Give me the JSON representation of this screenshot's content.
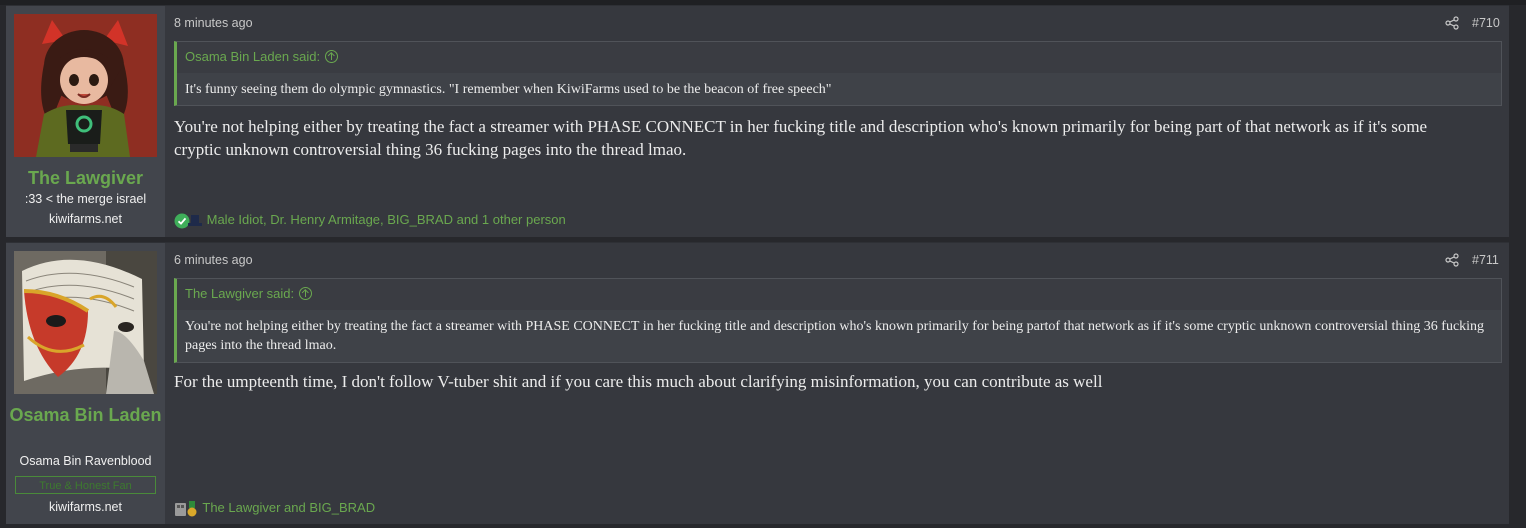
{
  "posts": [
    {
      "author": "The Lawgiver",
      "user_title": ":33 < the merge israel",
      "user_extra": "kiwifarms.net",
      "time": "8 minutes ago",
      "post_number": "#710",
      "quote": {
        "author_line": "Osama Bin Laden said:",
        "text": "It's funny seeing them do olympic gymnastics. \"I remember when KiwiFarms used to be the beacon of free speech\""
      },
      "message": "You're not helping either by treating the fact a streamer with PHASE CONNECT in her fucking title and description who's known primarily for being part of that network as if it's some cryptic unknown controversial thing 36 fucking pages into the thread lmao.",
      "reactions": "Male Idiot, Dr. Henry Armitage, BIG_BRAD and 1 other person"
    },
    {
      "author": "Osama Bin Laden",
      "user_title": "Osama Bin Ravenblood",
      "user_banner": "True & Honest Fan",
      "user_extra": "kiwifarms.net",
      "time": "6 minutes ago",
      "post_number": "#711",
      "quote": {
        "author_line": "The Lawgiver said:",
        "text": "You're not helping either by treating the fact a streamer with PHASE CONNECT in her fucking title and description who's known primarily for being partof that network as if it's some cryptic unknown controversial thing 36 fucking pages into the thread lmao."
      },
      "message": "For the umpteenth time, I don't follow V-tuber shit and if you care this much about clarifying misinformation, you can contribute as well",
      "reactions": "The Lawgiver and BIG_BRAD"
    }
  ],
  "colors": {
    "accent": "#6aa84f",
    "page_bg": "#27282c",
    "post_bg": "#36383e",
    "user_cell_bg": "#42454c"
  }
}
